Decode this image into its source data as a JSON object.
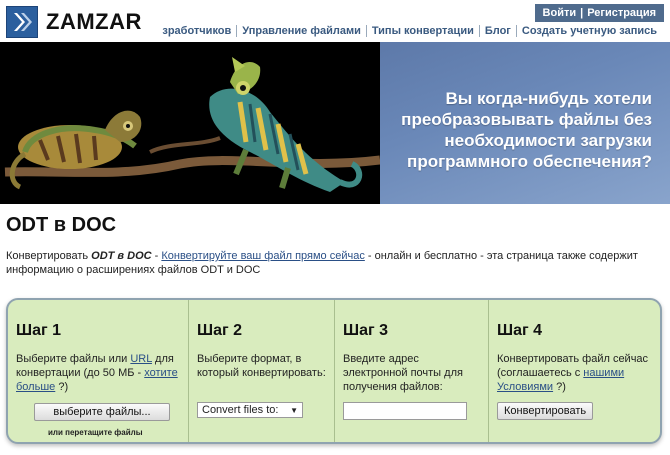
{
  "header": {
    "brand": "ZAMZAR",
    "auth": {
      "login": "Войти",
      "separator": "|",
      "register": "Регистрация"
    },
    "nav": [
      "зработчиков",
      "Управление файлами",
      "Типы конвертации",
      "Блог",
      "Создать учетную запись"
    ]
  },
  "banner": {
    "text": "Вы когда-нибудь хотели преобразовывать файлы без необходимости загрузки программного обеспечения?"
  },
  "page": {
    "title": "ODT в DOC",
    "intro": {
      "prefix": "Конвертировать ",
      "bold": "ODT в DOC",
      "dash": " - ",
      "link": "Конвертируйте ваш файл прямо сейчас",
      "suffix": " - онлайн и бесплатно - эта страница также содержит информацию о расширениях файлов ODT и DOC"
    }
  },
  "steps": {
    "step1": {
      "title": "Шаг 1",
      "desc_a": "Выберите файлы или ",
      "desc_link1": "URL",
      "desc_b": " для конвертации (до 50 МБ - ",
      "desc_link2": "хотите больше",
      "desc_c": " ?)",
      "button": "выберите файлы...",
      "drag_note": "или перетащите файлы"
    },
    "step2": {
      "title": "Шаг 2",
      "desc": "Выберите формат, в который конвертировать:",
      "select_value": "Convert files to:",
      "select_arrow": "▼"
    },
    "step3": {
      "title": "Шаг 3",
      "desc": "Введите адрес электронной почты для получения файлов:"
    },
    "step4": {
      "title": "Шаг 4",
      "desc_a": "Конвертировать файл сейчас (соглашаетесь с ",
      "desc_link": "нашими Условиями",
      "desc_b": " ?)",
      "button": "Конвертировать"
    }
  }
}
